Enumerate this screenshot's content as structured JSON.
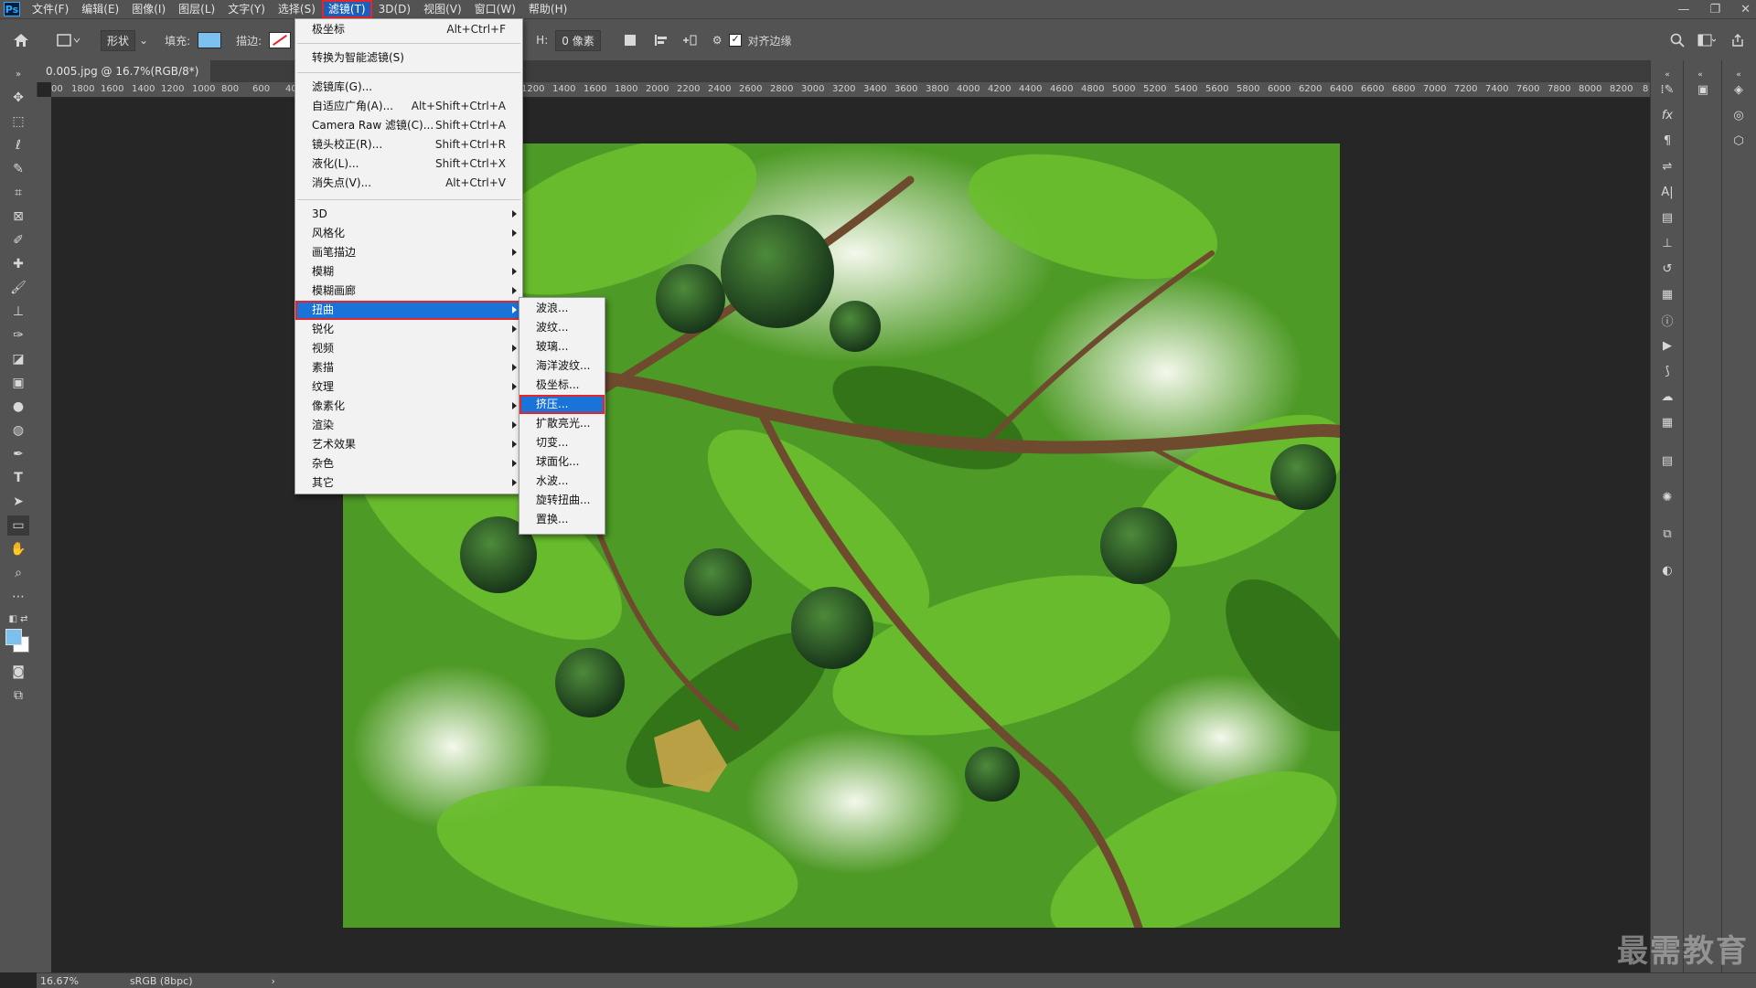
{
  "menubar": {
    "logo": "Ps",
    "items": [
      "文件(F)",
      "编辑(E)",
      "图像(I)",
      "图层(L)",
      "文字(Y)",
      "选择(S)",
      "滤镜(T)",
      "3D(D)",
      "视图(V)",
      "窗口(W)",
      "帮助(H)"
    ],
    "active_index": 6
  },
  "options": {
    "shape_mode": "形状",
    "fill_label": "填充:",
    "stroke_label": "描边:",
    "h_label": "H:",
    "h_value": "0 像素",
    "align_edges": "对齐边缘",
    "fill_color": "#7cc0f0"
  },
  "tab": {
    "title": "0.005.jpg @ 16.7%(RGB/8*)",
    "close": "×"
  },
  "ruler": [
    "00",
    "1800",
    "1600",
    "1400",
    "1200",
    "1000",
    "800",
    "600",
    "40",
    "1200",
    "1400",
    "1600",
    "1800",
    "2000",
    "2200",
    "2400",
    "2600",
    "2800",
    "3000",
    "3200",
    "3400",
    "3600",
    "3800",
    "4000",
    "4200",
    "4400",
    "4600",
    "4800",
    "5000",
    "5200",
    "5400",
    "5600",
    "5800",
    "6000",
    "6200",
    "6400",
    "6600",
    "6800",
    "7000",
    "7200",
    "7400",
    "7600",
    "7800",
    "8000",
    "8200",
    "8"
  ],
  "filter_menu": {
    "last_filter": "极坐标",
    "last_filter_sc": "Alt+Ctrl+F",
    "smart": "转换为智能滤镜(S)",
    "group2": [
      {
        "label": "滤镜库(G)...",
        "sc": ""
      },
      {
        "label": "自适应广角(A)...",
        "sc": "Alt+Shift+Ctrl+A"
      },
      {
        "label": "Camera Raw 滤镜(C)...",
        "sc": "Shift+Ctrl+A"
      },
      {
        "label": "镜头校正(R)...",
        "sc": "Shift+Ctrl+R"
      },
      {
        "label": "液化(L)...",
        "sc": "Shift+Ctrl+X"
      },
      {
        "label": "消失点(V)...",
        "sc": "Alt+Ctrl+V"
      }
    ],
    "submenus": [
      "3D",
      "风格化",
      "画笔描边",
      "模糊",
      "模糊画廊",
      "扭曲",
      "锐化",
      "视频",
      "素描",
      "纹理",
      "像素化",
      "渲染",
      "艺术效果",
      "杂色",
      "其它"
    ],
    "highlight_index": 5
  },
  "distort_menu": {
    "items": [
      "波浪...",
      "波纹...",
      "玻璃...",
      "海洋波纹...",
      "极坐标...",
      "挤压...",
      "扩散亮光...",
      "切变...",
      "球面化...",
      "水波...",
      "旋转扭曲...",
      "置换..."
    ],
    "highlight_index": 5
  },
  "status": {
    "zoom": "16.67%",
    "profile": "sRGB (8bpc)"
  },
  "watermark": "最需教育",
  "colors": {
    "highlight": "#1a73d8",
    "outline": "#e2262c",
    "ui": "#535353"
  }
}
